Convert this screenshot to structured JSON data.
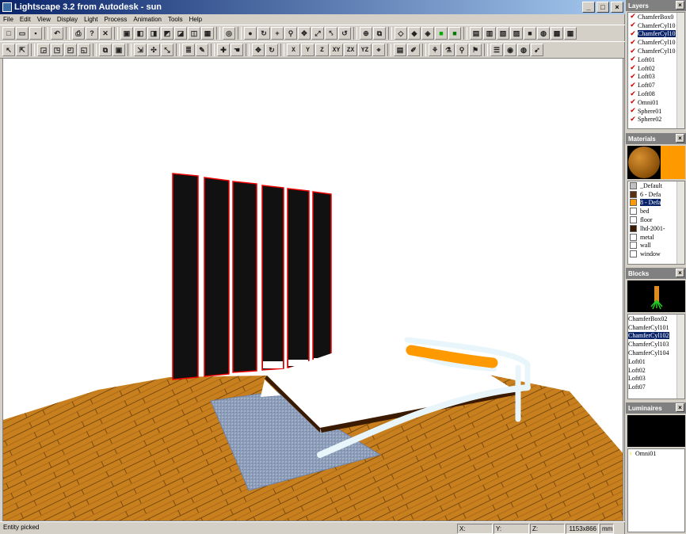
{
  "window": {
    "title": "Lightscape 3.2 from Autodesk - sun",
    "controls": [
      "_",
      "□",
      "×"
    ]
  },
  "menu": [
    "File",
    "Edit",
    "View",
    "Display",
    "Light",
    "Process",
    "Animation",
    "Tools",
    "Help"
  ],
  "toolbar2_axes": [
    "X",
    "Y",
    "Z",
    "XY",
    "ZX",
    "YZ"
  ],
  "status": {
    "message": "Entity picked",
    "x_label": "X:",
    "y_label": "Y:",
    "z_label": "Z:",
    "resolution": "1153x866",
    "units": "mm"
  },
  "layers": {
    "title": "Layers",
    "items": [
      "ChamferBox0",
      "ChamferCyl10",
      "ChamferCyl10",
      "ChamferCyl10",
      "ChamferCyl10",
      "Loft01",
      "Loft02",
      "Loft03",
      "Loft07",
      "Loft08",
      "Omni01",
      "Sphere01",
      "Sphere02"
    ],
    "selected_index": 2
  },
  "materials": {
    "title": "Materials",
    "items": [
      {
        "name": "_Default",
        "color": "#c0c0c0"
      },
      {
        "name": "6 - Defa",
        "color": "#5a3010"
      },
      {
        "name": "8 - Defa",
        "color": "#ff9900"
      },
      {
        "name": "bed",
        "color": "#ffffff"
      },
      {
        "name": "floor",
        "color": "#ffffff"
      },
      {
        "name": "lhd-2001-",
        "color": "#3a1a00"
      },
      {
        "name": "metal",
        "color": "#ffffff"
      },
      {
        "name": "wall",
        "color": "#ffffff"
      },
      {
        "name": "window",
        "color": "#ffffff"
      }
    ],
    "selected_index": 2
  },
  "blocks": {
    "title": "Blocks",
    "items": [
      "ChamferBox02",
      "ChamferCyl101",
      "ChamferCyl102",
      "ChamferCyl103",
      "ChamferCyl104",
      "Loft01",
      "Loft02",
      "Loft03",
      "Loft07"
    ],
    "selected_index": 2
  },
  "luminaires": {
    "title": "Luminaires",
    "items": [
      "Omni01"
    ]
  },
  "colors": {
    "titlebar_start": "#0a246a",
    "floor": "#c8801e",
    "rug": "#8a9cb8",
    "pillow": "#ff9900",
    "window_frame": "#e00000",
    "window_glass": "#111111"
  }
}
